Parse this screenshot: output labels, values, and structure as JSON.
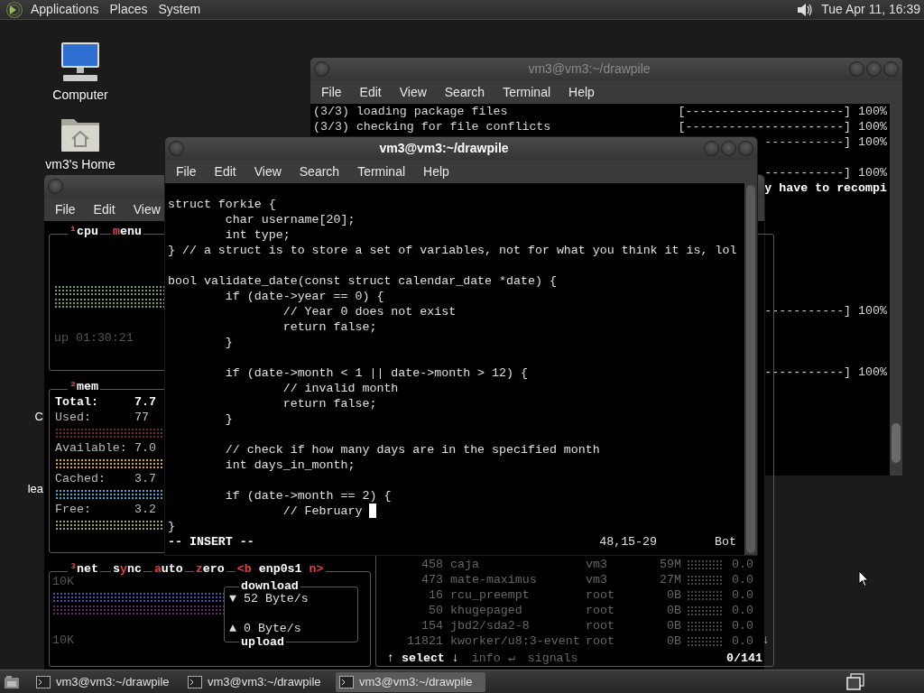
{
  "top_panel": {
    "menus": [
      "Applications",
      "Places",
      "System"
    ],
    "clock": "Tue Apr 11, 16:39"
  },
  "desktop_icons": [
    {
      "kind": "computer",
      "label": "Computer"
    },
    {
      "kind": "home",
      "label": "vm3's Home"
    }
  ],
  "peeking_labels": [
    "C",
    "lea"
  ],
  "back_terminal": {
    "title": "vm3@vm3:~/drawpile",
    "active": false,
    "menu": [
      "File",
      "Edit",
      "View",
      "Search",
      "Terminal",
      "Help"
    ],
    "rows": [
      {
        "kind": "line",
        "left": "(3/3) loading package files",
        "right": "[----------------------] 100%",
        "bold": false
      },
      {
        "kind": "line",
        "left": "(3/3) checking for file conflicts",
        "right": "[----------------------] 100%",
        "bold": false
      },
      {
        "kind": "line",
        "right": "-----------] 100%",
        "bold": false
      },
      {
        "kind": "blank"
      },
      {
        "kind": "line",
        "right": "-----------] 100%",
        "bold": false
      },
      {
        "kind": "line",
        "right": "y have to recompi",
        "bold": true
      },
      {
        "kind": "blank"
      },
      {
        "kind": "blank"
      },
      {
        "kind": "blank"
      },
      {
        "kind": "blank"
      },
      {
        "kind": "blank"
      },
      {
        "kind": "blank"
      },
      {
        "kind": "blank"
      },
      {
        "kind": "line",
        "right": "-----------] 100%",
        "bold": false
      },
      {
        "kind": "blank"
      },
      {
        "kind": "blank"
      },
      {
        "kind": "blank"
      },
      {
        "kind": "line",
        "right": "-----------] 100%",
        "bold": false
      }
    ]
  },
  "front_terminal": {
    "title": "vm3@vm3:~/drawpile",
    "active": true,
    "menu": [
      "File",
      "Edit",
      "View",
      "Search",
      "Terminal",
      "Help"
    ],
    "lines": [
      {
        "kind": "code",
        "text": "struct forkie {",
        "cursor": false
      },
      {
        "kind": "code",
        "text": "        char username[20];",
        "cursor": false
      },
      {
        "kind": "code",
        "text": "        int type;",
        "cursor": false
      },
      {
        "kind": "code",
        "text": "} // a struct is to store a set of variables, not for what you think it is, lol",
        "cursor": false
      },
      {
        "kind": "blank"
      },
      {
        "kind": "code",
        "text": "bool validate_date(const struct calendar_date *date) {",
        "cursor": false
      },
      {
        "kind": "code",
        "text": "        if (date->year == 0) {",
        "cursor": false
      },
      {
        "kind": "code",
        "text": "                // Year 0 does not exist",
        "cursor": false
      },
      {
        "kind": "code",
        "text": "                return false;",
        "cursor": false
      },
      {
        "kind": "code",
        "text": "        }",
        "cursor": false
      },
      {
        "kind": "blank"
      },
      {
        "kind": "code",
        "text": "        if (date->month < 1 || date->month > 12) {",
        "cursor": false
      },
      {
        "kind": "code",
        "text": "                // invalid month",
        "cursor": false
      },
      {
        "kind": "code",
        "text": "                return false;",
        "cursor": false
      },
      {
        "kind": "code",
        "text": "        }",
        "cursor": false
      },
      {
        "kind": "blank"
      },
      {
        "kind": "code",
        "text": "        // check if how many days are in the specified month",
        "cursor": false
      },
      {
        "kind": "code",
        "text": "        int days_in_month;",
        "cursor": false
      },
      {
        "kind": "blank"
      },
      {
        "kind": "code",
        "text": "        if (date->month == 2) {",
        "cursor": false
      },
      {
        "kind": "code",
        "text": "                // February ",
        "cursor": true
      },
      {
        "kind": "code",
        "text": "}",
        "cursor": false
      }
    ],
    "mode": "-- INSERT --",
    "position": "48,15-29",
    "scroll": "Bot"
  },
  "monitor_window": {
    "menu": [
      "File",
      "Edit",
      "View"
    ],
    "cpu": {
      "title": [
        {
          "text": "¹",
          "hot": true
        },
        {
          "text": "cpu",
          "hot": false
        }
      ],
      "menu": [
        {
          "text": "m",
          "hot": true
        },
        {
          "text": "enu",
          "hot": false
        }
      ],
      "uptime": "up 01:30:21"
    },
    "mem": {
      "title": [
        {
          "text": "²",
          "hot": true
        },
        {
          "text": "mem",
          "hot": false
        }
      ],
      "rows": [
        {
          "kind": "total",
          "label": "Total:",
          "value": "7.7"
        },
        {
          "kind": "meter",
          "label": "Used:",
          "value": "77",
          "color": "#6e2f2f"
        },
        {
          "kind": "meter",
          "label": "Available:",
          "value": "7.0",
          "color": "#d9a43a"
        },
        {
          "kind": "meter",
          "label": "Cached:",
          "value": "3.7",
          "color": "#4aa6cc"
        },
        {
          "kind": "meter",
          "label": "Free:",
          "value": "3.2",
          "color": "#9aa85e"
        }
      ]
    },
    "net": {
      "title": [
        {
          "text": "³",
          "hot": true
        },
        {
          "text": "net",
          "hot": false
        }
      ],
      "options": [
        [
          {
            "text": "s",
            "hot": false
          },
          {
            "text": "y",
            "hot": true
          },
          {
            "text": "nc",
            "hot": false
          }
        ],
        [
          {
            "text": "a",
            "hot": true
          },
          {
            "text": "uto",
            "hot": false
          }
        ],
        [
          {
            "text": "z",
            "hot": true
          },
          {
            "text": "ero",
            "hot": false
          }
        ],
        [
          {
            "text": "<b ",
            "hot": true
          },
          {
            "text": "enp0s1",
            "hot": false
          },
          {
            "text": " n>",
            "hot": true
          }
        ]
      ],
      "scale_top": "10K",
      "scale_bottom": "10K",
      "download_label": "download",
      "download": "▼ 52 Byte/s",
      "upload": "▲ 0 Byte/s",
      "upload_label": "upload"
    },
    "processes": {
      "rows": [
        {
          "pid": "458",
          "name": "caja",
          "user": "vm3",
          "mem": "59M",
          "cpu": "0.0"
        },
        {
          "pid": "473",
          "name": "mate-maximus",
          "user": "vm3",
          "mem": "27M",
          "cpu": "0.0"
        },
        {
          "pid": "16",
          "name": "rcu_preempt",
          "user": "root",
          "mem": "0B",
          "cpu": "0.0"
        },
        {
          "pid": "50",
          "name": "khugepaged",
          "user": "root",
          "mem": "0B",
          "cpu": "0.0"
        },
        {
          "pid": "154",
          "name": "jbd2/sda2-8",
          "user": "root",
          "mem": "0B",
          "cpu": "0.0"
        },
        {
          "pid": "11821",
          "name": "kworker/u8:3-event",
          "user": "root",
          "mem": "0B",
          "cpu": "0.0"
        }
      ],
      "scroll_marker": "↓",
      "footer": [
        {
          "text": "↑ select ↓",
          "selected": true
        },
        {
          "text": "info ↵",
          "selected": false
        },
        {
          "text": "signals",
          "selected": false
        }
      ],
      "count": "0/141"
    }
  },
  "taskbar": {
    "tasks": [
      {
        "label": "vm3@vm3:~/drawpile",
        "selected": false
      },
      {
        "label": "vm3@vm3:~/drawpile",
        "selected": false
      },
      {
        "label": "vm3@vm3:~/drawpile",
        "selected": true
      }
    ]
  }
}
